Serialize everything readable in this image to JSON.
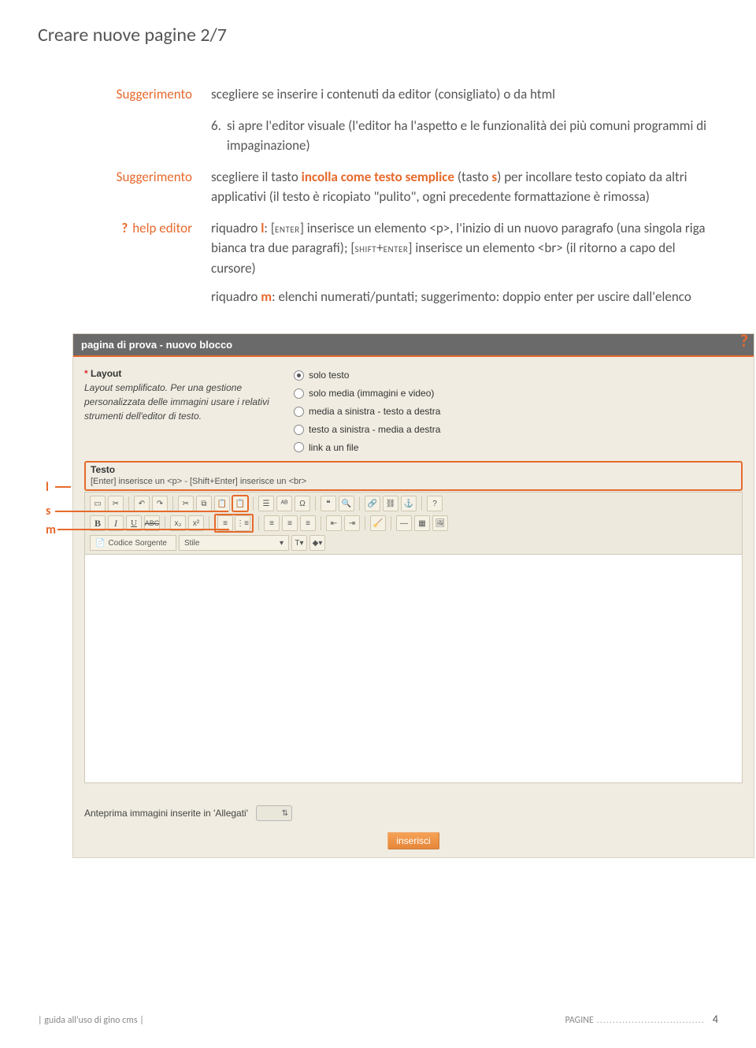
{
  "page": {
    "title": "Creare nuove pagine 2/7",
    "footer_left": "| guida all'uso di gino cms |",
    "footer_section": "PAGINE",
    "footer_dots": "..................................",
    "footer_page": "4"
  },
  "rows": {
    "sug1_label": "Suggerimento",
    "sug1_text": "scegliere se inserire i contenuti da editor (consigliato) o da html",
    "step_num": "6.",
    "step_text": "si apre l'editor visuale (l'editor ha l'aspetto e le funzionalità dei più comuni programmi di impaginazione)",
    "sug2_label": "Suggerimento",
    "sug2_a": "scegliere il tasto",
    "sug2_b": "incolla come testo semplice",
    "sug2_c": "(tasto",
    "sug2_d": "s",
    "sug2_e": ") per incollare testo copiato da altri applicativi (il testo è ricopiato \"pulito\", ogni precedente formattazione è rimossa)",
    "help_q": "?",
    "help_label": "help editor",
    "help_p1a": "riquadro",
    "help_l": "l",
    "help_p1b": ": [",
    "help_sc1": "enter",
    "help_p1c": "] inserisce un elemento <p>, l'inizio di un nuovo paragrafo (una singola riga bianca tra due paragrafi); [",
    "help_sc2": "shift",
    "help_plus": "+",
    "help_sc3": "enter",
    "help_p1d": "] inserisce un elemento <br> (il ritorno a capo del cursore)",
    "help_p2a": "riquadro",
    "help_m": "m",
    "help_p2b": ": elenchi numerati/puntati; suggerimento: doppio enter per uscire dall'elenco"
  },
  "annot": {
    "l": "l",
    "s": "s",
    "m": "m",
    "q": "?"
  },
  "panel": {
    "header": "pagina di prova - nuovo blocco",
    "layout_req": "*",
    "layout_title": "Layout",
    "layout_desc": "Layout semplificato. Per una gestione personalizzata delle immagini usare i relativi strumenti dell'editor di testo.",
    "radios": [
      {
        "label": "solo testo",
        "selected": true
      },
      {
        "label": "solo media (immagini e video)",
        "selected": false
      },
      {
        "label": "media a sinistra - testo a destra",
        "selected": false
      },
      {
        "label": "testo a sinistra - media a destra",
        "selected": false
      },
      {
        "label": "link a un file",
        "selected": false
      }
    ],
    "testo_title": "Testo",
    "testo_hint": "[Enter] inserisce un <p> - [Shift+Enter] inserisce un <br>",
    "source_btn": "Codice Sorgente",
    "style_label": "Stile",
    "preview_label": "Anteprima immagini inserite in 'Allegati'",
    "insert_btn": "inserisci"
  }
}
